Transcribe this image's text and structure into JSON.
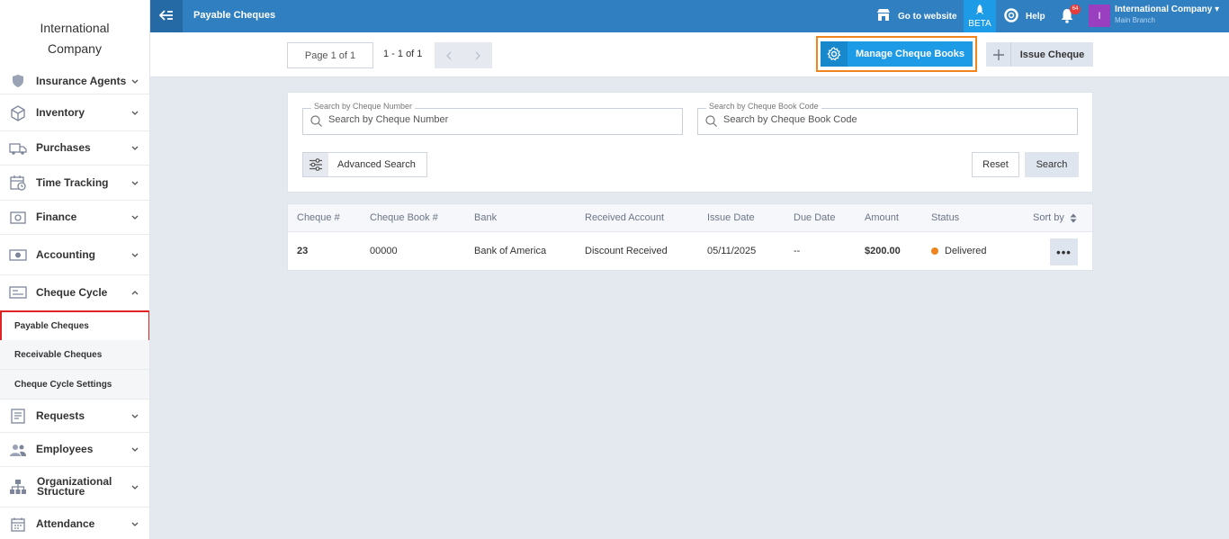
{
  "company": {
    "logo_line1": "International",
    "logo_line2": "Company"
  },
  "sidebar": {
    "items": [
      {
        "label": "Insurance Agents",
        "icon": "shield-icon"
      },
      {
        "label": "Inventory",
        "icon": "box-icon"
      },
      {
        "label": "Purchases",
        "icon": "truck-icon"
      },
      {
        "label": "Time Tracking",
        "icon": "calendar-clock-icon"
      },
      {
        "label": "Finance",
        "icon": "safe-icon"
      },
      {
        "label": "Accounting",
        "icon": "money-icon"
      },
      {
        "label": "Cheque Cycle",
        "icon": "cheque-icon"
      },
      {
        "label": "Requests",
        "icon": "clipboard-icon"
      },
      {
        "label": "Employees",
        "icon": "people-icon"
      },
      {
        "label": "Organizational Structure",
        "label_line1": "Organizational",
        "label_line2": "Structure",
        "icon": "org-chart-icon"
      },
      {
        "label": "Attendance",
        "icon": "calendar-icon"
      }
    ],
    "sub_items": [
      {
        "label": "Payable Cheques",
        "active": true
      },
      {
        "label": "Receivable Cheques"
      },
      {
        "label": "Cheque Cycle Settings"
      }
    ]
  },
  "topbar": {
    "title": "Payable Cheques",
    "go_to_website": "Go to website",
    "beta": "BETA",
    "help": "Help",
    "notification_count": "64",
    "company_name": "International Company",
    "branch": "Main Branch",
    "avatar_letter": "I"
  },
  "toolbar": {
    "page_label": "Page 1 of 1",
    "count_label": "1 - 1 of 1",
    "manage_label": "Manage Cheque Books",
    "issue_label": "Issue Cheque"
  },
  "search": {
    "cheque_number_label": "Search by Cheque Number",
    "cheque_number_placeholder": "Search by Cheque Number",
    "book_code_label": "Search by Cheque Book Code",
    "book_code_placeholder": "Search by Cheque Book Code",
    "advanced": "Advanced Search",
    "reset": "Reset",
    "search": "Search"
  },
  "table": {
    "headers": [
      "Cheque #",
      "Cheque Book #",
      "Bank",
      "Received Account",
      "Issue Date",
      "Due Date",
      "Amount",
      "Status"
    ],
    "sort_by": "Sort by",
    "rows": [
      {
        "cheque_no": "23",
        "book_no": "00000",
        "bank": "Bank of America",
        "account": "Discount Received",
        "issue_date": "05/11/2025",
        "due_date": "--",
        "amount": "$200.00",
        "status": "Delivered",
        "more": "•••"
      }
    ]
  },
  "colors": {
    "topbar": "#2f7fc1",
    "accent": "#1d9be6",
    "highlight_outline": "#f0851f",
    "active_outline": "#e02424",
    "status_delivered": "#f0851f"
  }
}
